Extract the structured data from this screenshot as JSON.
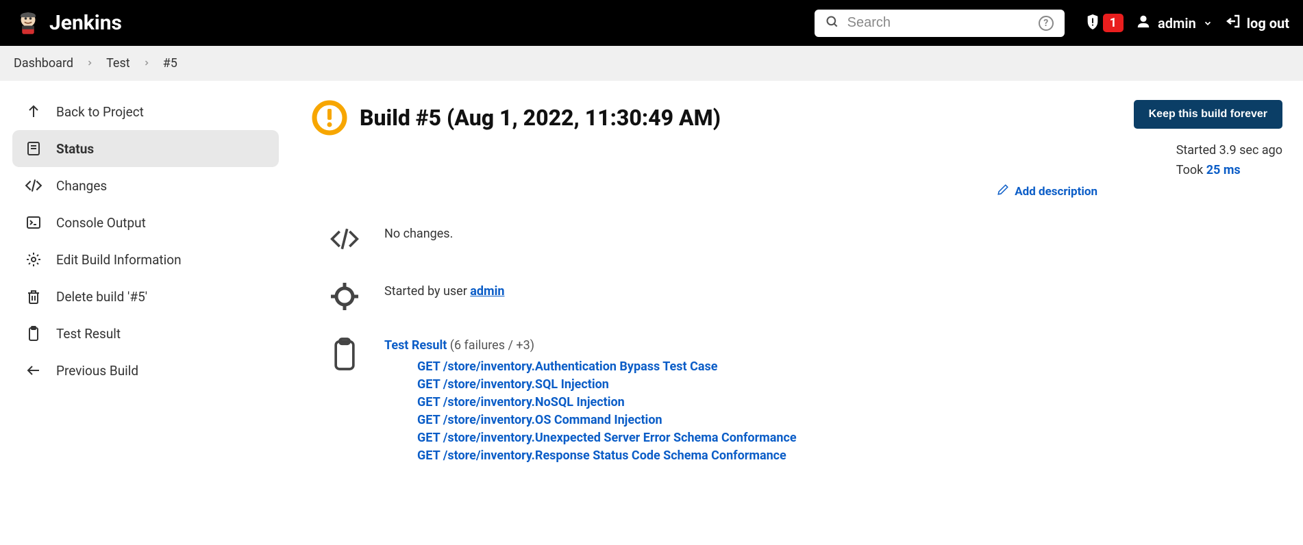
{
  "header": {
    "brand": "Jenkins",
    "search_placeholder": "Search",
    "notif_count": "1",
    "username": "admin",
    "logout_label": "log out"
  },
  "breadcrumb": {
    "items": [
      "Dashboard",
      "Test",
      "#5"
    ]
  },
  "sidebar": {
    "items": [
      {
        "label": "Back to Project"
      },
      {
        "label": "Status"
      },
      {
        "label": "Changes"
      },
      {
        "label": "Console Output"
      },
      {
        "label": "Edit Build Information"
      },
      {
        "label": "Delete build '#5'"
      },
      {
        "label": "Test Result"
      },
      {
        "label": "Previous Build"
      }
    ]
  },
  "build": {
    "title": "Build #5 (Aug 1, 2022, 11:30:49 AM)",
    "keep_button": "Keep this build forever",
    "started_text": "Started 3.9 sec ago",
    "took_prefix": "Took ",
    "took_value": "25 ms",
    "add_description": "Add description",
    "no_changes": "No changes.",
    "started_by_prefix": "Started by user ",
    "started_by_user": "admin",
    "test_result_label": "Test Result",
    "test_result_summary": " (6 failures / +3)",
    "failures": [
      "GET /store/inventory.Authentication Bypass Test Case",
      "GET /store/inventory.SQL Injection",
      "GET /store/inventory.NoSQL Injection",
      "GET /store/inventory.OS Command Injection",
      "GET /store/inventory.Unexpected Server Error Schema Conformance",
      "GET /store/inventory.Response Status Code Schema Conformance"
    ]
  }
}
